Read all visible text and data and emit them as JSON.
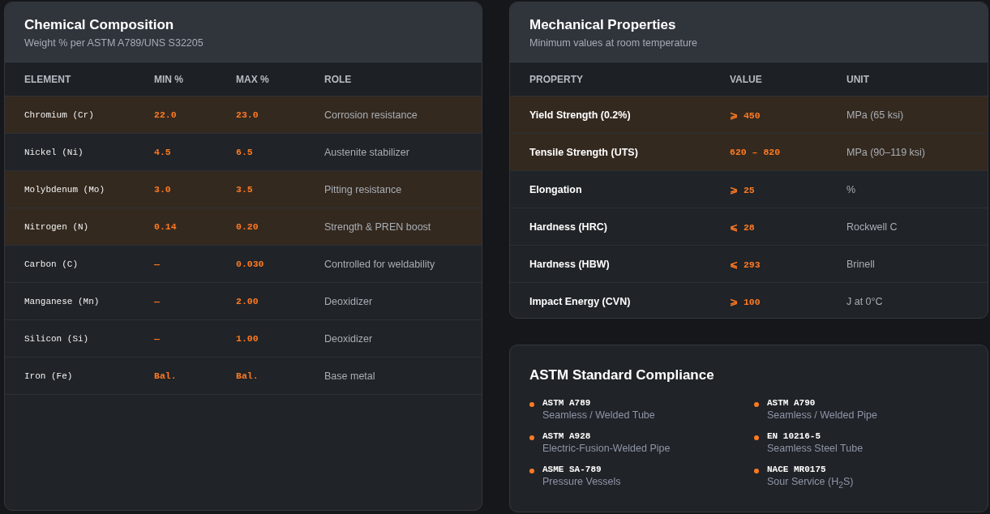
{
  "composition": {
    "title": "Chemical Composition",
    "subtitle": "Weight % per ASTM A789/UNS S32205",
    "columns": [
      "ELEMENT",
      "MIN %",
      "MAX %",
      "ROLE"
    ],
    "rows": [
      {
        "element": "Chromium (Cr)",
        "min": "22.0",
        "max": "23.0",
        "role": "Corrosion resistance",
        "highlighted": true
      },
      {
        "element": "Nickel (Ni)",
        "min": "4.5",
        "max": "6.5",
        "role": "Austenite stabilizer",
        "highlighted": false
      },
      {
        "element": "Molybdenum (Mo)",
        "min": "3.0",
        "max": "3.5",
        "role": "Pitting resistance",
        "highlighted": true
      },
      {
        "element": "Nitrogen (N)",
        "min": "0.14",
        "max": "0.20",
        "role": "Strength & PREN boost",
        "highlighted": true
      },
      {
        "element": "Carbon (C)",
        "min": "—",
        "max": "0.030",
        "role": "Controlled for weldability",
        "highlighted": false
      },
      {
        "element": "Manganese (Mn)",
        "min": "—",
        "max": "2.00",
        "role": "Deoxidizer",
        "highlighted": false
      },
      {
        "element": "Silicon (Si)",
        "min": "—",
        "max": "1.00",
        "role": "Deoxidizer",
        "highlighted": false
      },
      {
        "element": "Iron (Fe)",
        "min": "Bal.",
        "max": "Bal.",
        "role": "Base metal",
        "highlighted": false
      }
    ]
  },
  "mechanical": {
    "title": "Mechanical Properties",
    "subtitle": "Minimum values at room temperature",
    "columns": [
      "PROPERTY",
      "VALUE",
      "UNIT"
    ],
    "rows": [
      {
        "property": "Yield Strength (0.2%)",
        "value": "⩾ 450",
        "unit": "MPa (65 ksi)",
        "highlighted": true
      },
      {
        "property": "Tensile Strength (UTS)",
        "value": "620 – 820",
        "unit": "MPa (90–119 ksi)",
        "highlighted": true
      },
      {
        "property": "Elongation",
        "value": "⩾ 25",
        "unit": "%",
        "highlighted": false
      },
      {
        "property": "Hardness (HRC)",
        "value": "⩽ 28",
        "unit": "Rockwell C",
        "highlighted": false
      },
      {
        "property": "Hardness (HBW)",
        "value": "⩽ 293",
        "unit": "Brinell",
        "highlighted": false
      },
      {
        "property": "Impact Energy (CVN)",
        "value": "⩾ 100",
        "unit": "J at 0°C",
        "highlighted": false
      }
    ]
  },
  "compliance": {
    "title": "ASTM Standard Compliance",
    "items": [
      {
        "code": "ASTM A789",
        "description": "Seamless / Welded Tube"
      },
      {
        "code": "ASTM A790",
        "description": "Seamless / Welded Pipe"
      },
      {
        "code": "ASTM A928",
        "description": "Electric-Fusion-Welded Pipe"
      },
      {
        "code": "EN 10216-5",
        "description": "Seamless Steel Tube"
      },
      {
        "code": "ASME SA-789",
        "description": "Pressure Vessels"
      },
      {
        "code": "NACE MR0175",
        "description": "Sour Service (H$_{2}$S)"
      }
    ]
  }
}
